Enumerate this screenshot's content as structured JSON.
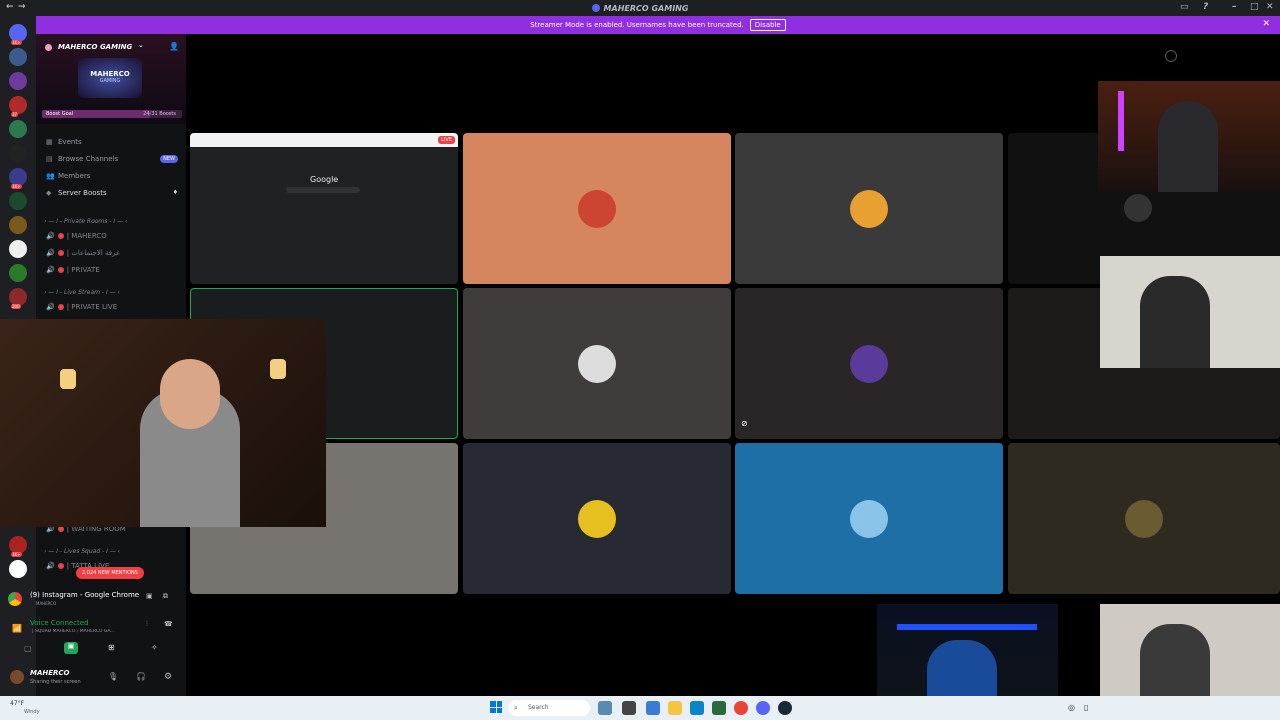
{
  "window": {
    "title": "MAHERCO GAMING"
  },
  "banner": {
    "text": "Streamer Mode is enabled. Usernames have been truncated.",
    "button": "Disable"
  },
  "rail": {
    "badges": [
      "1K+",
      "37",
      "1K+",
      "200",
      "1K+"
    ]
  },
  "server": {
    "name": "MAHERCO GAMING",
    "banner_title": "MAHERCO",
    "banner_sub": "GAMING",
    "boost_label": "Boost Goal",
    "boost_count": "24/31 Boosts",
    "boost_progress": 0.77
  },
  "nav": {
    "events": "Events",
    "browse": "Browse Channels",
    "browse_badge": "NEW",
    "members": "Members",
    "boosts": "Server Boosts"
  },
  "categories": {
    "private": "I - Private Rooms - I",
    "live": "I - Live Stream - I",
    "squad": "I - Lives Squad - I"
  },
  "channels": {
    "maherco": "| MAHERCO",
    "arabic": "| غرفة الاجتماعات",
    "private": "| PRIVATE",
    "private_live": "| PRIVATE LIVE",
    "waiting": "| WAITING ROOM",
    "tatta": "| TATTA LIVE"
  },
  "mentions": "2,024 NEW MENTIONS",
  "activity": {
    "title": "(9) Instagram - Google Chrome",
    "sub": "MAHERCO"
  },
  "voice": {
    "status": "Voice Connected",
    "channel": "| SQUAD MAHERCO / MAHERCO GA..."
  },
  "user": {
    "name": "MAHERCO",
    "status": "Sharing their screen"
  },
  "grid": {
    "live_badge": "LIVE",
    "google": "Google"
  },
  "taskbar": {
    "weather": "47°F",
    "weather_sub": "Windy",
    "search": "Search"
  }
}
